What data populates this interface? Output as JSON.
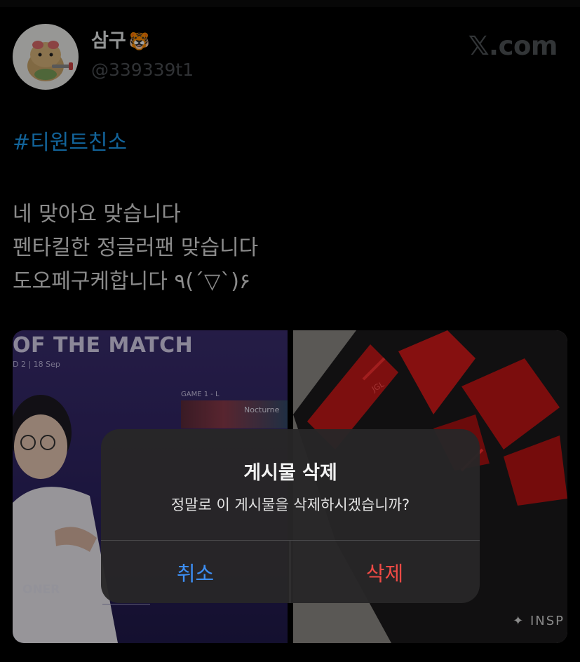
{
  "tweet": {
    "display_name": "삼구",
    "name_emoji": "🐯",
    "handle": "@339339t1",
    "site_logo": "𝕏.com",
    "hashtag": "#티원트친소",
    "lines": [
      "네 맞아요 맞습니다",
      "펜타킬한 정글러팬 맞습니다",
      "도오페구케합니다 ٩(´▽`)۶"
    ]
  },
  "media": {
    "left": {
      "title": "OF THE MATCH",
      "subtitle": "D 2 | 18 Sep",
      "game_label": "GAME 1 -  L",
      "champion": "Nocturne",
      "player": "ONER"
    },
    "right": {
      "jersey_tag": "JGL",
      "jersey_text": "✦ INSP"
    }
  },
  "alert": {
    "title": "게시물 삭제",
    "message": "정말로 이 게시물을 삭제하시겠습니까?",
    "cancel_label": "취소",
    "delete_label": "삭제"
  },
  "colors": {
    "hashtag": "#1d9bf0",
    "cancel": "#3d8ff5",
    "delete": "#ef4a45"
  }
}
